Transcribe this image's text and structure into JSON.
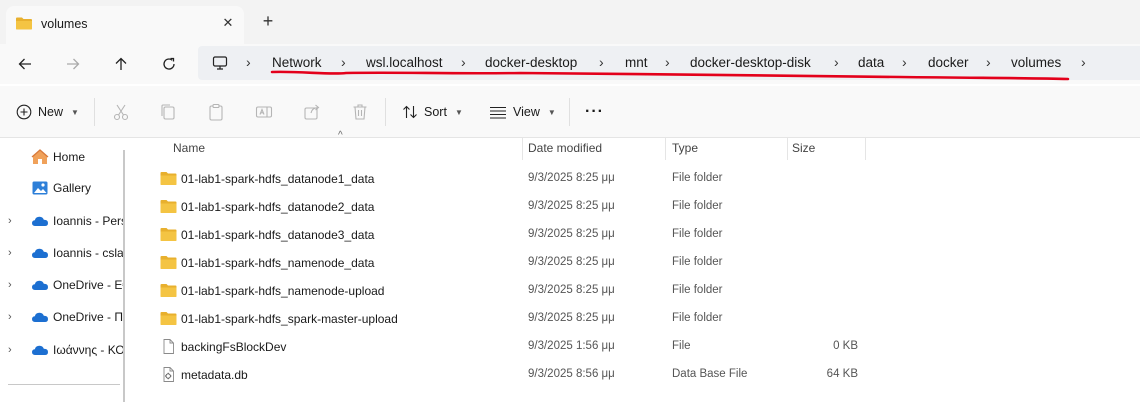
{
  "tab": {
    "title": "volumes",
    "close_glyph": "✕",
    "new_glyph": "+"
  },
  "nav": {
    "back_icon": "arrow-left-icon",
    "forward_icon": "arrow-right-icon",
    "up_icon": "arrow-up-icon",
    "refresh_icon": "refresh-icon",
    "breadcrumbs": [
      "Network",
      "wsl.localhost",
      "docker-desktop",
      "mnt",
      "docker-desktop-disk",
      "data",
      "docker",
      "volumes"
    ],
    "separator": "›"
  },
  "toolbar": {
    "new_label": "New",
    "sort_label": "Sort",
    "view_label": "View",
    "more_label": "···"
  },
  "sidebar": {
    "items": [
      {
        "label": "Home",
        "icon": "home-icon",
        "expandable": false
      },
      {
        "label": "Gallery",
        "icon": "gallery-icon",
        "expandable": false
      },
      {
        "label": "Ioannis - Pers",
        "icon": "onedrive-icon",
        "expandable": true
      },
      {
        "label": "Ioannis - csla",
        "icon": "onedrive-icon",
        "expandable": true
      },
      {
        "label": "OneDrive - Ε€",
        "icon": "onedrive-icon",
        "expandable": true
      },
      {
        "label": "OneDrive - Π",
        "icon": "onedrive-icon",
        "expandable": true
      },
      {
        "label": "Ιωάννης - ΚΟ",
        "icon": "onedrive-icon",
        "expandable": true
      }
    ]
  },
  "columns": {
    "name": "Name",
    "date": "Date modified",
    "type": "Type",
    "size": "Size"
  },
  "files": [
    {
      "name": "01-lab1-spark-hdfs_datanode1_data",
      "date": "9/3/2025 8:25 μμ",
      "type": "File folder",
      "size": "",
      "icon": "folder-icon"
    },
    {
      "name": "01-lab1-spark-hdfs_datanode2_data",
      "date": "9/3/2025 8:25 μμ",
      "type": "File folder",
      "size": "",
      "icon": "folder-icon"
    },
    {
      "name": "01-lab1-spark-hdfs_datanode3_data",
      "date": "9/3/2025 8:25 μμ",
      "type": "File folder",
      "size": "",
      "icon": "folder-icon"
    },
    {
      "name": "01-lab1-spark-hdfs_namenode_data",
      "date": "9/3/2025 8:25 μμ",
      "type": "File folder",
      "size": "",
      "icon": "folder-icon"
    },
    {
      "name": "01-lab1-spark-hdfs_namenode-upload",
      "date": "9/3/2025 8:25 μμ",
      "type": "File folder",
      "size": "",
      "icon": "folder-icon"
    },
    {
      "name": "01-lab1-spark-hdfs_spark-master-upload",
      "date": "9/3/2025 8:25 μμ",
      "type": "File folder",
      "size": "",
      "icon": "folder-icon"
    },
    {
      "name": "backingFsBlockDev",
      "date": "9/3/2025 1:56 μμ",
      "type": "File",
      "size": "0 KB",
      "icon": "file-icon"
    },
    {
      "name": "metadata.db",
      "date": "9/3/2025 8:56 μμ",
      "type": "Data Base File",
      "size": "64 KB",
      "icon": "database-file-icon"
    }
  ],
  "colors": {
    "folder": "#f4c443",
    "folder_dark": "#e8b02e",
    "onedrive": "#1c6fd1",
    "annotation": "#e3001b"
  }
}
